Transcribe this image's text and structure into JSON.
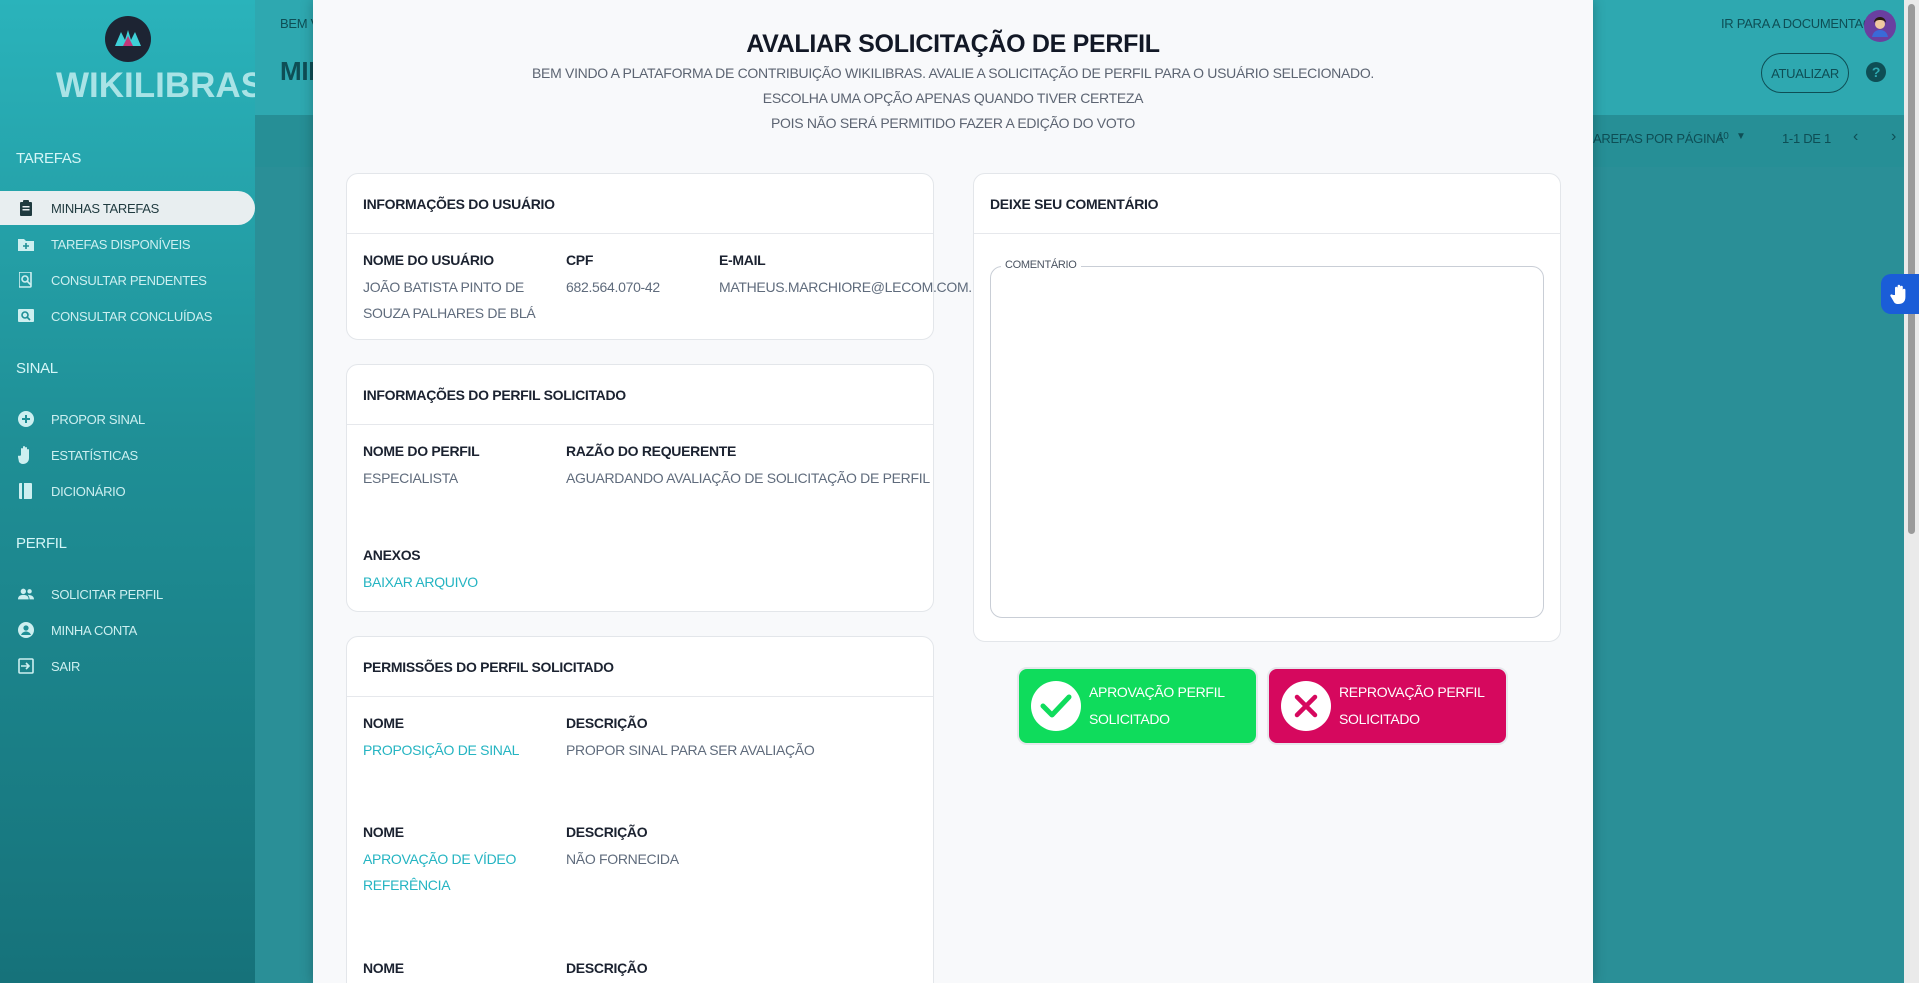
{
  "sidebar": {
    "logo_text": "WIKILIBRAS",
    "sections": [
      {
        "title": "Tarefas",
        "items": [
          {
            "label": "Minhas Tarefas",
            "icon": "clipboard-icon",
            "active": true
          },
          {
            "label": "Tarefas Disponíveis",
            "icon": "folder-plus-icon"
          },
          {
            "label": "Consultar Pendentes",
            "icon": "search-doc-icon"
          },
          {
            "label": "Consultar Concluídas",
            "icon": "search-image-icon"
          }
        ]
      },
      {
        "title": "Sinal",
        "items": [
          {
            "label": "Propor Sinal",
            "icon": "plus-circle-icon"
          },
          {
            "label": "Estatísticas",
            "icon": "hand-icon"
          },
          {
            "label": "Dicionário",
            "icon": "book-icon"
          }
        ]
      },
      {
        "title": "Perfil",
        "items": [
          {
            "label": "Solicitar Perfil",
            "icon": "people-icon"
          },
          {
            "label": "Minha Conta",
            "icon": "account-icon"
          },
          {
            "label": "Sair",
            "icon": "logout-icon"
          }
        ]
      }
    ]
  },
  "page": {
    "welcome": "Bem vi",
    "title_partial": "MINH",
    "doc_link": "Ir para a documentação",
    "refresh_button": "Atualizar",
    "per_page_label": "arefas por página",
    "per_page_value": "10",
    "pagination": "1-1 de 1"
  },
  "modal": {
    "title": "Avaliar Solicitação de Perfil",
    "subtitle_line1": "Bem vindo a plataforma de contribuição WikiLibras. Avalie a solicitação de perfil para o usuário selecionado. Escolha uma opção apenas quando tiver certeza",
    "subtitle_line2": "pois não será permitido fazer a edição do voto",
    "user_info": {
      "header": "Informações do Usuário",
      "name_label": "Nome do Usuário",
      "name_value_1": "João Batista Pinto de",
      "name_value_2": "Souza Palhares de Blá",
      "cpf_label": "CPF",
      "cpf_value": "682.564.070-42",
      "email_label": "E-mail",
      "email_value": "matheus.marchiore@lecom.com.br"
    },
    "profile_info": {
      "header": "Informações do Perfil Solicitado",
      "profile_label": "Nome do Perfil",
      "profile_value": "Especialista",
      "reason_label": "Razão do Requerente",
      "reason_value": "Aguardando avaliação de solicitação de perfil",
      "attachments_label": "Anexos",
      "attachments_link": "Baixar Arquivo"
    },
    "permissions": {
      "header": "Permissões do Perfil Solicitado",
      "items": [
        {
          "name_label": "Nome",
          "name_1": "Proposição de Sinal",
          "name_2": "",
          "desc_label": "Descrição",
          "desc": "Propor sinal para ser avaliação"
        },
        {
          "name_label": "Nome",
          "name_1": "Aprovação de Vídeo",
          "name_2": "Referência",
          "desc_label": "Descrição",
          "desc": "Não fornecida"
        },
        {
          "name_label": "Nome",
          "name_1": "",
          "name_2": "",
          "desc_label": "Descrição",
          "desc": ""
        }
      ]
    },
    "comment": {
      "header": "Deixe seu Comentário",
      "field_label": "Comentário",
      "value": ""
    },
    "approve_button": "Aprovação Perfil Solicitado",
    "reject_button_1": "Reprovação Perfil",
    "reject_button_2": "Solicitado"
  },
  "colors": {
    "sidebar_top": "#2ab3bb",
    "sidebar_bottom": "#16727a",
    "approve": "#0fdc5c",
    "reject": "#d6085e",
    "link": "#24b4c2"
  }
}
